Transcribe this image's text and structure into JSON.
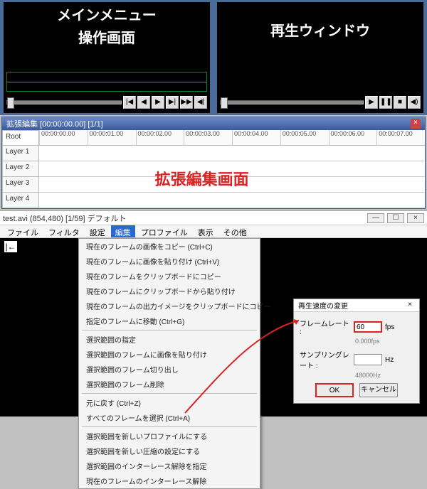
{
  "panes": {
    "left_label_l1": "メインメニュー",
    "left_label_l2": "操作画面",
    "right_label": "再生ウィンドウ"
  },
  "transport_icons": {
    "prev": "|◀",
    "rew": "◀",
    "play": "▶",
    "next": "▶|",
    "last": "▶▶",
    "end": "◀|",
    "play2": "▶",
    "pause": "❚❚",
    "stop": "■",
    "vol": "◀)"
  },
  "timeline": {
    "title": "拡張編集  [00:00:00.00]  [1/1]",
    "root": "Root",
    "layers": [
      "Layer 1",
      "Layer 2",
      "Layer 3",
      "Layer 4"
    ],
    "ticks": [
      "00:00:00.00",
      "00:00:01.00",
      "00:00:02.00",
      "00:00:03.00",
      "00:00:04.00",
      "00:00:05.00",
      "00:00:06.00",
      "00:00:07.00"
    ],
    "overlay": "拡張編集画面"
  },
  "editor": {
    "title": "test.avi (854,480) [1/59] デフォルト",
    "menus": [
      "ファイル",
      "フィルタ",
      "設定",
      "編集",
      "プロファイル",
      "表示",
      "その他"
    ],
    "active_menu_index": 3,
    "context_items": [
      "現在のフレームの画像をコピー (Ctrl+C)",
      "現在のフレームに画像を貼り付け (Ctrl+V)",
      "現在のフレームをクリップボードにコピー",
      "現在のフレームにクリップボードから貼り付け",
      "現在のフレームの出力イメージをクリップボードにコピー",
      "指定のフレームに移動 (Ctrl+G)",
      "-",
      "選択範囲の指定",
      "選択範囲のフレームに画像を貼り付け",
      "選択範囲のフレーム切り出し",
      "選択範囲のフレーム削除",
      "-",
      "元に戻す (Ctrl+Z)",
      "すべてのフレームを選択 (Ctrl+A)",
      "-",
      "選択範囲を新しいプロファイルにする",
      "選択範囲を新しい圧縮の設定にする",
      "選択範囲のインターレース解除を指定",
      "現在のフレームのインターレース解除"
    ]
  },
  "dialog": {
    "title": "再生速度の変更",
    "row1_label": "フレームレート :",
    "row1_value": "60",
    "row1_unit": "fps",
    "row1_hint": "0.000fps",
    "row2_label": "サンプリングレート :",
    "row2_value": "",
    "row2_unit": "Hz",
    "row2_hint": "48000Hz",
    "ok": "OK",
    "cancel": "キャンセル"
  }
}
